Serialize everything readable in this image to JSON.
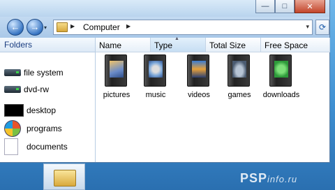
{
  "window_controls": {
    "minimize": "—",
    "maximize": "□",
    "close": "✕"
  },
  "nav": {
    "back": "←",
    "forward": "→",
    "dropdown": "▾"
  },
  "address": {
    "path": "Computer",
    "dropdown": "▾",
    "refresh": "⟳"
  },
  "sidebar": {
    "header": "Folders",
    "drives": [
      {
        "label": "file system",
        "icon": "hard-drive-icon"
      },
      {
        "label": "dvd-rw",
        "icon": "dvd-drive-icon"
      }
    ],
    "places": [
      {
        "label": "desktop",
        "icon": "monitor-icon"
      },
      {
        "label": "programs",
        "icon": "windows-logo-icon"
      },
      {
        "label": "documents",
        "icon": "document-icon"
      }
    ]
  },
  "columns": [
    {
      "label": "Name"
    },
    {
      "label": "Type",
      "sorted": true
    },
    {
      "label": "Total Size"
    },
    {
      "label": "Free Space"
    }
  ],
  "items": [
    {
      "label": "pictures",
      "icon": "pictures-folder-icon"
    },
    {
      "label": "music",
      "icon": "music-folder-icon"
    },
    {
      "label": "videos",
      "icon": "videos-folder-icon"
    },
    {
      "label": "games",
      "icon": "games-folder-icon"
    },
    {
      "label": "downloads",
      "icon": "downloads-folder-icon"
    }
  ],
  "watermark": {
    "main": "PSP",
    "suffix": "info.ru"
  }
}
